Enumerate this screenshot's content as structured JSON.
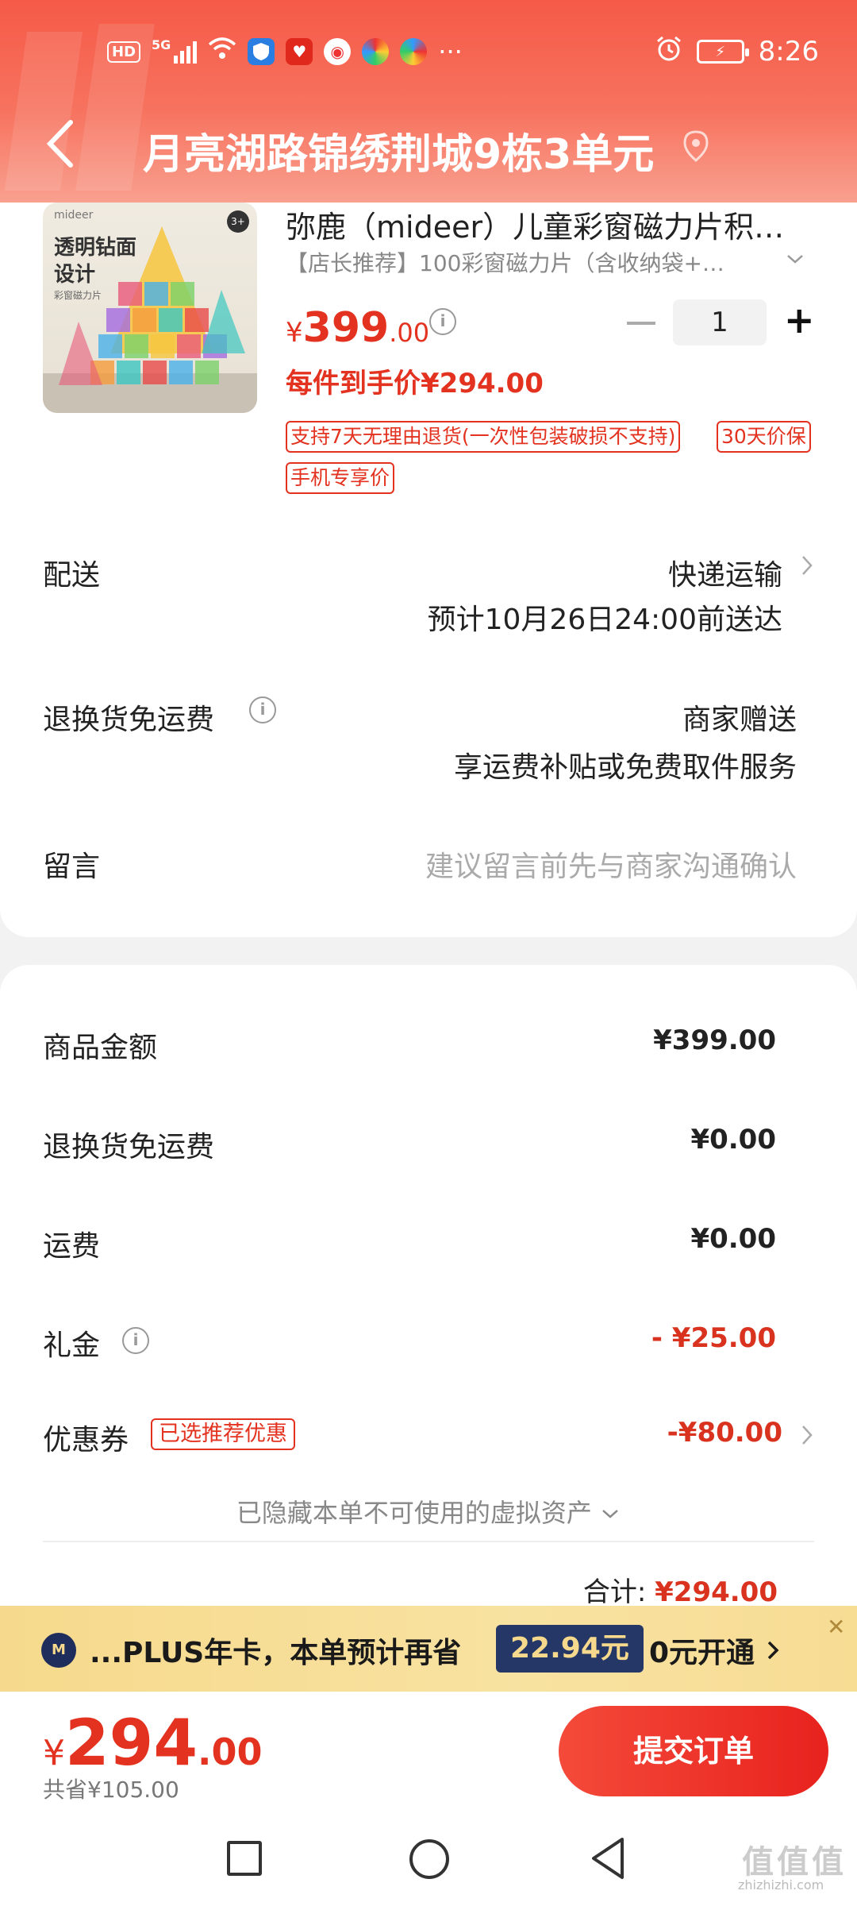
{
  "status_bar": {
    "hd": "HD",
    "network": "5G",
    "time": "8:26",
    "more": "···"
  },
  "header": {
    "address": "月亮湖路锦绣荆城9栋3单元"
  },
  "product": {
    "thumb_brand": "mideer",
    "thumb_title": "透明钻面设计",
    "thumb_sub": "彩窗磁力片",
    "thumb_age": "3+",
    "title": "弥鹿（mideer）儿童彩窗磁力片积…",
    "subtitle": "【店长推荐】100彩窗磁力片（含收纳袋+…",
    "price_symbol": "¥",
    "price_int": "399",
    "price_dec": ".00",
    "quantity": "1",
    "hand_price": "每件到手价¥294.00",
    "tags": [
      "支持7天无理由退货(一次性包装破损不支持)",
      "30天价保",
      "手机专享价"
    ]
  },
  "delivery": {
    "label": "配送",
    "method": "快递运输",
    "eta": "预计10月26日24:00前送达"
  },
  "return_shipping": {
    "label": "退换货免运费",
    "value": "商家赠送",
    "desc": "享运费补贴或免费取件服务"
  },
  "message": {
    "label": "留言",
    "placeholder": "建议留言前先与商家沟通确认"
  },
  "summary": {
    "rows": [
      {
        "label": "商品金额",
        "value": "¥399.00"
      },
      {
        "label": "退换货免运费",
        "value": "¥0.00"
      },
      {
        "label": "运费",
        "value": "¥0.00"
      },
      {
        "label": "礼金",
        "value": "- ¥25.00"
      },
      {
        "label": "优惠券",
        "value": "-¥80.00"
      }
    ],
    "coupon_tag": "已选推荐优惠",
    "hidden_assets": "已隐藏本单不可使用的虚拟资产",
    "total_label": "合计:",
    "total_value": "¥294.00"
  },
  "plus_banner": {
    "logo": "M",
    "text": "...PLUS年卡，本单预计再省",
    "badge": "22.94元",
    "cta": "0元开通",
    "close": "✕"
  },
  "bottom": {
    "symbol": "¥",
    "int": "294",
    "dec": ".00",
    "saved": "共省¥105.00",
    "submit": "提交订单"
  },
  "watermark": {
    "text": "值值值",
    "url": "zhizhizhi.com"
  },
  "colors": {
    "accent_red": "#e3321f",
    "header_red": "#f55a47",
    "plus_gold": "#f6d98c",
    "plus_navy": "#243767"
  }
}
